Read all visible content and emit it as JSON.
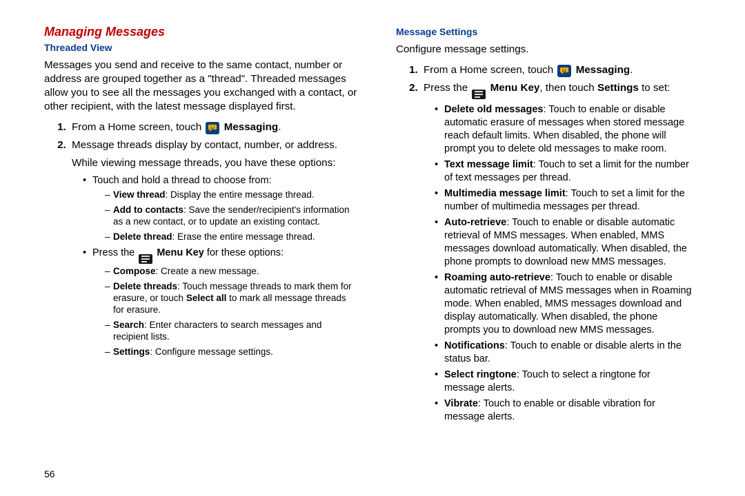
{
  "pageNumber": "56",
  "left": {
    "heading": "Managing Messages",
    "sub": "Threaded View",
    "intro": "Messages you send and receive to the same contact, number or address are grouped together as a \"thread\". Threaded messages allow you to see all the messages you exchanged with a contact, or other recipient, with the latest message displayed first.",
    "step1_a": "From a Home screen, touch ",
    "step1_b": "Messaging",
    "step1_c": ".",
    "step2": "Message threads display by contact, number, or address.",
    "step2b": "While viewing message threads, you have these options:",
    "opt1": "Touch and hold a thread to choose from:",
    "opt1_items": [
      {
        "t": "View thread",
        "d": ": Display the entire message thread."
      },
      {
        "t": "Add to contacts",
        "d": ": Save the sender/recipient's information as a new contact, or to update an existing contact."
      },
      {
        "t": "Delete thread",
        "d": ": Erase the entire message thread."
      }
    ],
    "opt2_a": "Press the ",
    "opt2_b": "Menu Key",
    "opt2_c": " for these options:",
    "opt2_items": [
      {
        "t": "Compose",
        "d": ": Create a new message."
      },
      {
        "t": "Delete threads",
        "d1": ": Touch message threads to mark them for erasure, or touch ",
        "b": "Select all",
        "d2": " to mark all message threads for erasure."
      },
      {
        "t": "Search",
        "d": ": Enter characters to search messages and recipient lists."
      },
      {
        "t": "Settings",
        "d": ": Configure message settings."
      }
    ]
  },
  "right": {
    "sub": "Message Settings",
    "intro": "Configure message settings.",
    "step1_a": "From a Home screen, touch ",
    "step1_b": "Messaging",
    "step1_c": ".",
    "step2_a": "Press the ",
    "step2_b": "Menu Key",
    "step2_c": ", then touch ",
    "step2_d": "Settings",
    "step2_e": " to set:",
    "items": [
      {
        "t": "Delete old messages",
        "d": ": Touch to enable or disable automatic erasure of messages when stored message reach default limits. When disabled, the phone will prompt you to delete old messages to make room."
      },
      {
        "t": "Text message limit",
        "d": ": Touch to set a limit for the number of text messages per thread."
      },
      {
        "t": "Multimedia message limit",
        "d": ": Touch to set a limit for the number of multimedia messages per thread."
      },
      {
        "t": "Auto-retrieve",
        "d": ": Touch to enable or disable automatic retrieval of MMS messages. When enabled, MMS messages download automatically. When disabled, the phone prompts to download new MMS messages."
      },
      {
        "t": "Roaming auto-retrieve",
        "d": ": Touch to enable or disable automatic retrieval of MMS messages when in Roaming mode. When enabled, MMS messages download and display automatically. When disabled, the phone prompts you to download new MMS messages."
      },
      {
        "t": "Notifications",
        "d": ": Touch to enable or disable alerts in the status bar."
      },
      {
        "t": "Select ringtone",
        "d": ": Touch to select a ringtone for message alerts."
      },
      {
        "t": "Vibrate",
        "d": ": Touch to enable or disable vibration for message alerts."
      }
    ]
  }
}
